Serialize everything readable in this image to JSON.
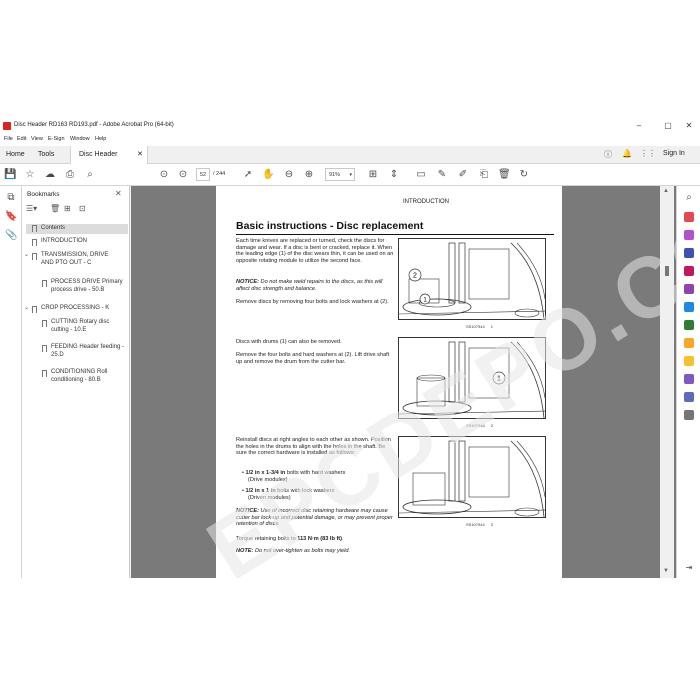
{
  "window": {
    "title": "Disc Header RD163 RD193.pdf - Adobe Acrobat Pro (64-bit)",
    "min": "–",
    "max": "▢",
    "close": "✕"
  },
  "menu": [
    "File",
    "Edit",
    "View",
    "E-Sign",
    "Window",
    "Help"
  ],
  "tabs": {
    "home": "Home",
    "tools": "Tools",
    "doc": "Disc Header RD163...",
    "doc_close": "✕",
    "signin": "Sign In"
  },
  "toolbar": {
    "page_current": "52",
    "page_total": "/ 244",
    "zoom": "91%"
  },
  "bookmarks": {
    "header": "Bookmarks",
    "items": [
      {
        "label": "Contents",
        "level": 0,
        "expand": "",
        "selected": true
      },
      {
        "label": "INTRODUCTION",
        "level": 0,
        "expand": "",
        "selected": false
      },
      {
        "label": "TRANSMISSION, DRIVE AND PTO OUT - C",
        "level": 0,
        "expand": "⌄",
        "selected": false
      },
      {
        "label": "PROCESS DRIVE Primary process drive - 50.B",
        "level": 1,
        "expand": "",
        "selected": false
      },
      {
        "label": "CROP PROCESSING - K",
        "level": 0,
        "expand": "⌄",
        "selected": false
      },
      {
        "label": "CUTTING Rotary disc cutting - 10.E",
        "level": 1,
        "expand": "",
        "selected": false
      },
      {
        "label": "FEEDING Header feeding - 25.D",
        "level": 1,
        "expand": "",
        "selected": false
      },
      {
        "label": "CONDITIONING Roll conditioning - 80.B",
        "level": 1,
        "expand": "",
        "selected": false
      }
    ]
  },
  "page": {
    "header": "INTRODUCTION",
    "section_title": "Basic instructions - Disc replacement",
    "p1": "Each time knives are replaced or turned, check the discs for damage and wear. If a disc is bent or cracked, replace it. When the leading edge (1) of the disc wears thin, it can be used on an opposite rotating module to utilize the second face.",
    "note1_label": "NOTICE:",
    "note1": " Do not make weld repairs to the discs, as this will affect disc strength and balance.",
    "p2": "Remove discs by removing four bolts and lock washers at (2).",
    "p3": "Discs with drums (1) can also be removed.",
    "p4": "Remove the four bolts and hard washers at (2). Lift drive shaft up and remove the drum from the cutter bar.",
    "p5": "Reinstall discs at right angles to each other as shown. Position the holes in the drums to align with the holes in the shaft. Be sure the correct hardware is installed as follows:",
    "b1_bold": "1/2 in x 1-3/4 in",
    "b1": " bolts with hard washers",
    "b1_sub": "(Drive modules)",
    "b2_bold": "1/2 in x 1 in",
    "b2": " bolts with lock washers",
    "b2_sub": "(Driven modules)",
    "note2_label": "NOTICE:",
    "note2": " Use of incorrect disc retaining hardware may cause cutter bar lock-up and potential damage, or may prevent proper retention of discs.",
    "torque_pre": "Torque retaining bolts to ",
    "torque_val": "113 N·m (83 lb ft)",
    "torque_post": ".",
    "note3_label": "NOTE:",
    "note3": " Do not over-tighten as bolts may yield.",
    "figures": [
      {
        "code": "SS107944",
        "num": "1",
        "callouts": [
          "2",
          "1"
        ]
      },
      {
        "code": "SS107944",
        "num": "2",
        "callouts": [
          "1"
        ]
      },
      {
        "code": "SS107944",
        "num": "3",
        "callouts": []
      }
    ]
  },
  "watermark": "EPCDEPO.COM",
  "colors": {
    "accent_red": "#d7261e",
    "doc_bg": "#7a7a7a"
  }
}
